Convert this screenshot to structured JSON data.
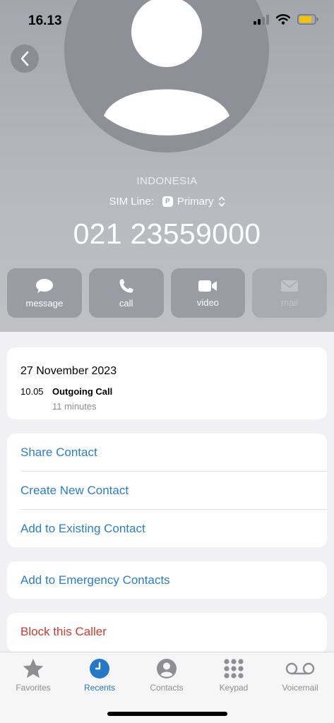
{
  "status_bar": {
    "time": "16.13"
  },
  "contact": {
    "country": "INDONESIA",
    "sim_label": "SIM Line:",
    "sim_badge": "P",
    "sim_value": "Primary",
    "phone_number": "021 23559000"
  },
  "actions": [
    {
      "label": "message",
      "icon": "message-icon",
      "enabled": true
    },
    {
      "label": "call",
      "icon": "phone-icon",
      "enabled": true
    },
    {
      "label": "video",
      "icon": "video-icon",
      "enabled": true
    },
    {
      "label": "mail",
      "icon": "mail-icon",
      "enabled": false
    }
  ],
  "recent": {
    "date": "27 November 2023",
    "time": "10.05",
    "type": "Outgoing Call",
    "duration": "11 minutes"
  },
  "options": [
    {
      "label": "Share Contact"
    },
    {
      "label": "Create New Contact"
    },
    {
      "label": "Add to Existing Contact"
    }
  ],
  "emergency": {
    "label": "Add to Emergency Contacts"
  },
  "block": {
    "label": "Block this Caller"
  },
  "tabs": [
    {
      "label": "Favorites",
      "icon": "star-icon",
      "active": false
    },
    {
      "label": "Recents",
      "icon": "clock-icon",
      "active": true
    },
    {
      "label": "Contacts",
      "icon": "person-icon",
      "active": false
    },
    {
      "label": "Keypad",
      "icon": "keypad-icon",
      "active": false
    },
    {
      "label": "Voicemail",
      "icon": "voicemail-icon",
      "active": false
    }
  ],
  "colors": {
    "accent": "#2478c8",
    "link": "#2a7fc4",
    "destructive": "#d03a30",
    "header": "#a4a6ae"
  }
}
